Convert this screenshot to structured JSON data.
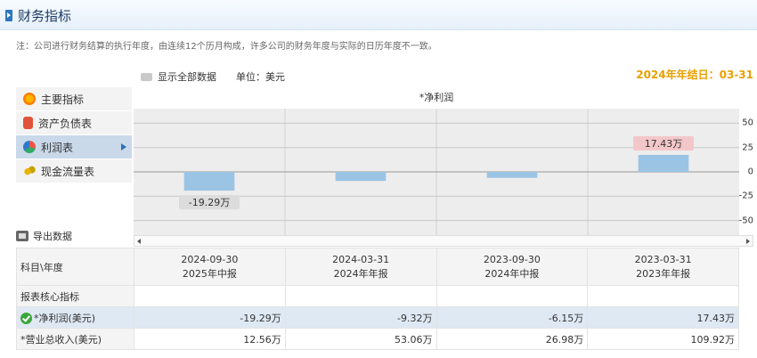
{
  "header": {
    "title": "财务指标"
  },
  "note": "注：公司进行财务结算的执行年度，由连续12个历月构成，许多公司的财务年度与实际的日历年度不一致。",
  "toolbar": {
    "show_all": "显示全部数据",
    "unit": "单位：美元",
    "year_end": "2024年年结日：03-31"
  },
  "sidebar": {
    "items": [
      {
        "label": "主要指标",
        "icon": "sun-icon"
      },
      {
        "label": "资产负债表",
        "icon": "document-icon"
      },
      {
        "label": "利润表",
        "icon": "pie-chart-icon",
        "active": true
      },
      {
        "label": "现金流量表",
        "icon": "coins-icon"
      }
    ],
    "export": "导出数据"
  },
  "colors": {
    "bar": "#9bc4e4",
    "label_neg": "#dcdcdc",
    "label_pos": "#f3c7c9",
    "active_side": "#c9d9ea",
    "accent": "#e8a000"
  },
  "chart_data": {
    "type": "bar",
    "title": "*净利润",
    "categories": [
      "2024-09-30",
      "2024-03-31",
      "2023-09-30",
      "2023-03-31"
    ],
    "values": [
      -19.29,
      -9.32,
      -6.15,
      17.43
    ],
    "data_labels": [
      "",
      "",
      "",
      "17.43万"
    ],
    "data_labels_below": [
      "-19.29万",
      "",
      "",
      ""
    ],
    "yticks": [
      50,
      25,
      0,
      -25,
      -50
    ],
    "ylim": [
      -65,
      65
    ],
    "grid": true
  },
  "table": {
    "corner": "科目\\年度",
    "columns": [
      {
        "date": "2024-09-30",
        "report": "2025年中报"
      },
      {
        "date": "2024-03-31",
        "report": "2024年年报"
      },
      {
        "date": "2023-09-30",
        "report": "2024年中报"
      },
      {
        "date": "2023-03-31",
        "report": "2023年年报"
      }
    ],
    "section": "报表核心指标",
    "rows": [
      {
        "label": "*净利润(美元)",
        "values": [
          "-19.29万",
          "-9.32万",
          "-6.15万",
          "17.43万"
        ],
        "highlight": true
      },
      {
        "label": "*营业总收入(美元)",
        "values": [
          "12.56万",
          "53.06万",
          "26.98万",
          "109.92万"
        ]
      }
    ]
  }
}
